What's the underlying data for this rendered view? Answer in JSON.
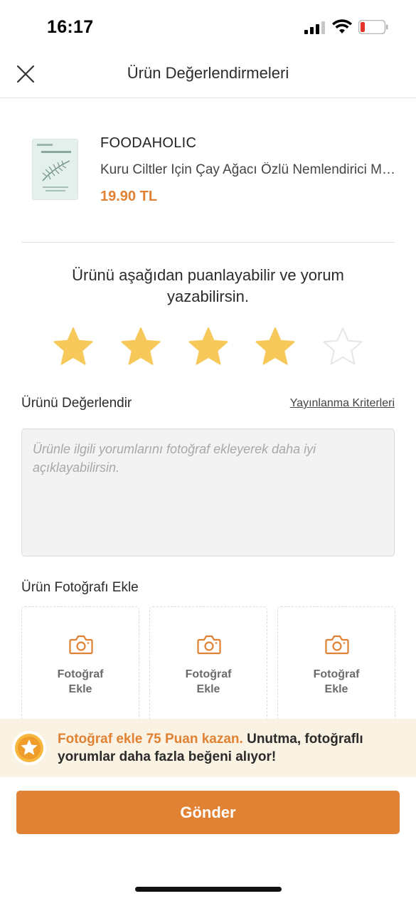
{
  "status_bar": {
    "time": "16:17",
    "icons": [
      "cellular-signal-icon",
      "wifi-icon",
      "battery-low-icon"
    ]
  },
  "header": {
    "title": "Ürün Değerlendirmeleri",
    "close_icon": "close-icon"
  },
  "product": {
    "brand": "FOODAHOLIC",
    "name": "Kuru Ciltler Için Çay Ağacı Özlü Nemlendirici Maske",
    "price": "19.90 TL",
    "image_icon": "face-mask-product-image"
  },
  "rating": {
    "prompt": "Ürünü aşağıdan puanlayabilir ve yorum yazabilirsin.",
    "value": 4,
    "max": 5
  },
  "review": {
    "label": "Ürünü Değerlendir",
    "criteria_link": "Yayınlanma Kriterleri",
    "placeholder": "Ürünle ilgili yorumlarını fotoğraf ekleyerek daha iyi açıklayabilirsin."
  },
  "photos": {
    "label": "Ürün Fotoğrafı Ekle",
    "slots": [
      {
        "label": "Fotoğraf\nEkle"
      },
      {
        "label": "Fotoğraf\nEkle"
      },
      {
        "label": "Fotoğraf\nEkle"
      }
    ]
  },
  "promo": {
    "highlight": "Fotoğraf ekle 75 Puan kazan.",
    "text": " Unutma, fotoğraflı yorumlar daha fazla beğeni alıyor!"
  },
  "submit_label": "Gönder",
  "colors": {
    "accent": "#e08133",
    "star_filled": "#f6c95a",
    "star_empty": "#e6e6e6",
    "promo_bg": "#faf2e2"
  }
}
